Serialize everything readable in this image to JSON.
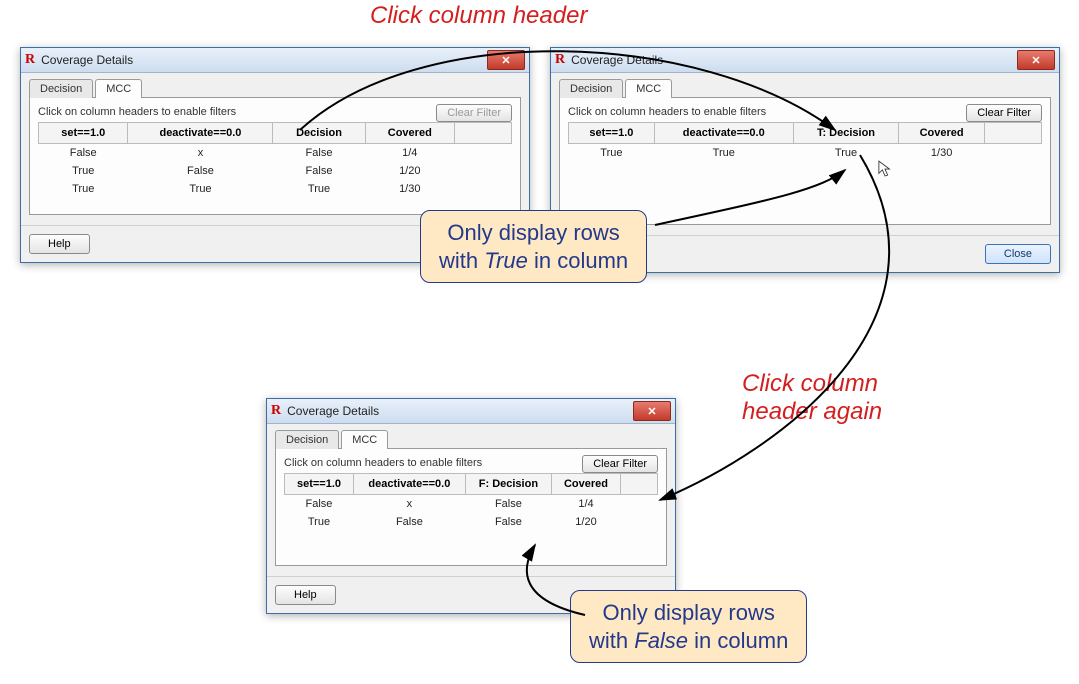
{
  "annotations": {
    "top": "Click column header",
    "right": "Click column\nheader again",
    "callout1_line1": "Only display rows",
    "callout1_line2_pre": "with ",
    "callout1_line2_em": "True",
    "callout1_line2_post": " in column",
    "callout2_line1": "Only display rows",
    "callout2_line2_pre": "with ",
    "callout2_line2_em": "False",
    "callout2_line2_post": " in column"
  },
  "common": {
    "title": "Coverage Details",
    "tab_decision": "Decision",
    "tab_mcc": "MCC",
    "hint": "Click on column headers to enable filters",
    "clear": "Clear Filter",
    "help": "Help",
    "close": "Close"
  },
  "win1": {
    "headers": [
      "set==1.0",
      "deactivate==0.0",
      "Decision",
      "Covered"
    ],
    "rows": [
      [
        "False",
        "x",
        "False",
        "1/4"
      ],
      [
        "True",
        "False",
        "False",
        "1/20"
      ],
      [
        "True",
        "True",
        "True",
        "1/30"
      ]
    ]
  },
  "win2": {
    "headers": [
      "set==1.0",
      "deactivate==0.0",
      "T: Decision",
      "Covered"
    ],
    "rows": [
      [
        "True",
        "True",
        "True",
        "1/30"
      ]
    ]
  },
  "win3": {
    "headers": [
      "set==1.0",
      "deactivate==0.0",
      "F: Decision",
      "Covered"
    ],
    "rows": [
      [
        "False",
        "x",
        "False",
        "1/4"
      ],
      [
        "True",
        "False",
        "False",
        "1/20"
      ]
    ]
  }
}
